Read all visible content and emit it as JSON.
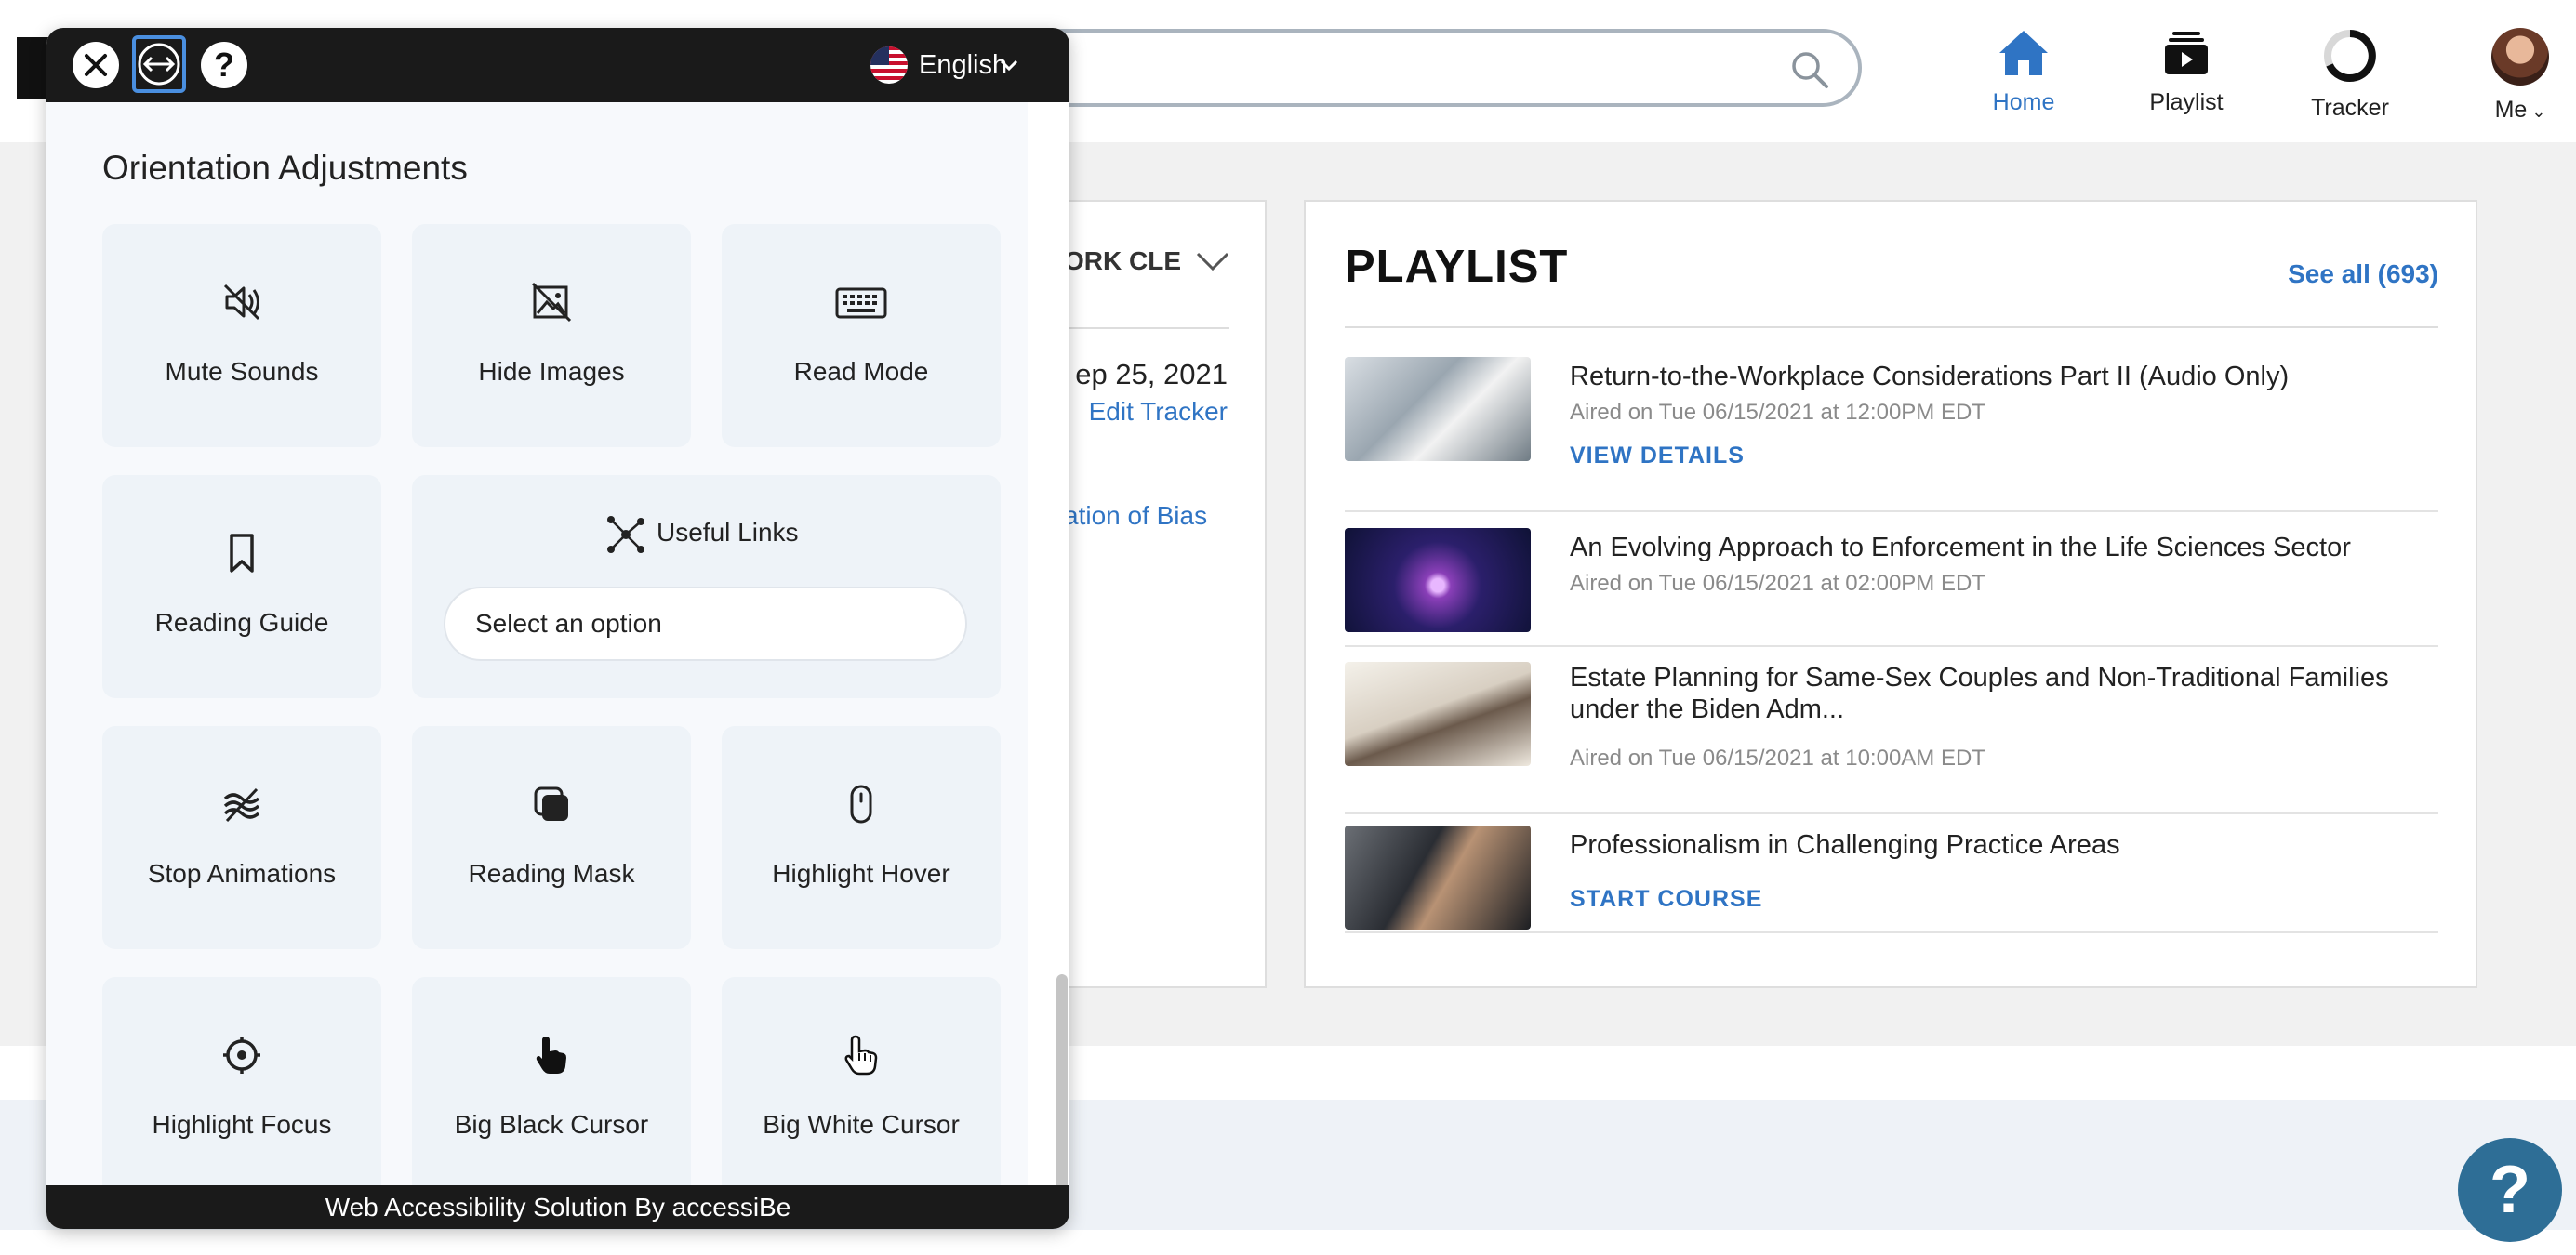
{
  "header": {
    "nav": [
      {
        "label": "Home",
        "icon": "home-icon"
      },
      {
        "label": "Playlist",
        "icon": "playlist-icon"
      },
      {
        "label": "Tracker",
        "icon": "tracker-icon"
      },
      {
        "label": "Me",
        "icon": "avatar"
      }
    ],
    "accent_color": "#2f74c4"
  },
  "left_panel": {
    "title_fragment": "ORK CLE",
    "date_fragment": "ep 25, 2021",
    "edit_link": "Edit Tracker",
    "link_fragment": "ation of Bias"
  },
  "playlist": {
    "heading": "PLAYLIST",
    "see_all": "See all (693)",
    "items": [
      {
        "title": "Return-to-the-Workplace Considerations Part II (Audio Only)",
        "aired": "Aired on Tue 06/15/2021 at 12:00PM EDT",
        "action": "VIEW DETAILS"
      },
      {
        "title": "An Evolving Approach to Enforcement in the Life Sciences Sector",
        "aired": "Aired on Tue 06/15/2021 at 02:00PM EDT",
        "action": ""
      },
      {
        "title": "Estate Planning for Same-Sex Couples and Non-Traditional Families under the Biden Adm...",
        "aired": "Aired on Tue 06/15/2021 at 10:00AM EDT",
        "action": ""
      },
      {
        "title": "Professionalism in Challenging Practice Areas",
        "aired": "",
        "action": "START COURSE"
      }
    ]
  },
  "widget": {
    "language": "English",
    "section_title": "Orientation Adjustments",
    "tiles": {
      "mute_sounds": "Mute Sounds",
      "hide_images": "Hide Images",
      "read_mode": "Read Mode",
      "reading_guide": "Reading Guide",
      "useful_links": "Useful Links",
      "useful_links_select": "Select an option",
      "stop_animations": "Stop Animations",
      "reading_mask": "Reading Mask",
      "highlight_hover": "Highlight Hover",
      "highlight_focus": "Highlight Focus",
      "big_black_cursor": "Big Black Cursor",
      "big_white_cursor": "Big White Cursor"
    },
    "footer": "Web Accessibility Solution By accessiBe"
  },
  "help_fab": "?"
}
